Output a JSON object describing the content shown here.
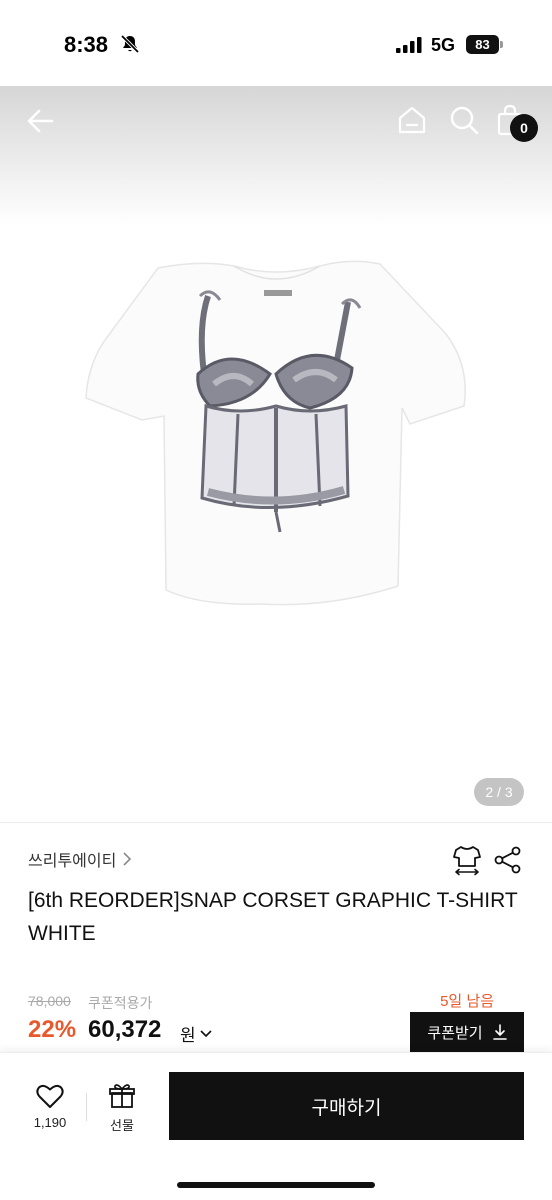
{
  "status_bar": {
    "time": "8:38",
    "network": "5G",
    "battery": "83"
  },
  "header": {
    "cart_count": "0"
  },
  "gallery": {
    "page_indicator": "2 / 3"
  },
  "product": {
    "brand": "쓰리투에이티",
    "title": "[6th REORDER]SNAP CORSET GRAPHIC T-SHIRT WHITE",
    "original_price": "78,000",
    "coupon_price_label": "쿠폰적용가",
    "days_left": "5일 남음",
    "discount_rate": "22%",
    "sale_price": "60,372",
    "currency": "원",
    "coupon_button_label": "쿠폰받기"
  },
  "bottom_bar": {
    "like_count": "1,190",
    "gift_label": "선물",
    "buy_label": "구매하기"
  },
  "colors": {
    "accent": "#e8582a",
    "primary": "#111111"
  },
  "icons": [
    "bell-slash-icon",
    "signal-icon",
    "back-arrow-icon",
    "home-icon",
    "search-icon",
    "shopping-bag-icon",
    "chevron-right-icon",
    "size-guide-icon",
    "share-icon",
    "chevron-down-icon",
    "download-icon",
    "heart-icon",
    "gift-icon"
  ]
}
